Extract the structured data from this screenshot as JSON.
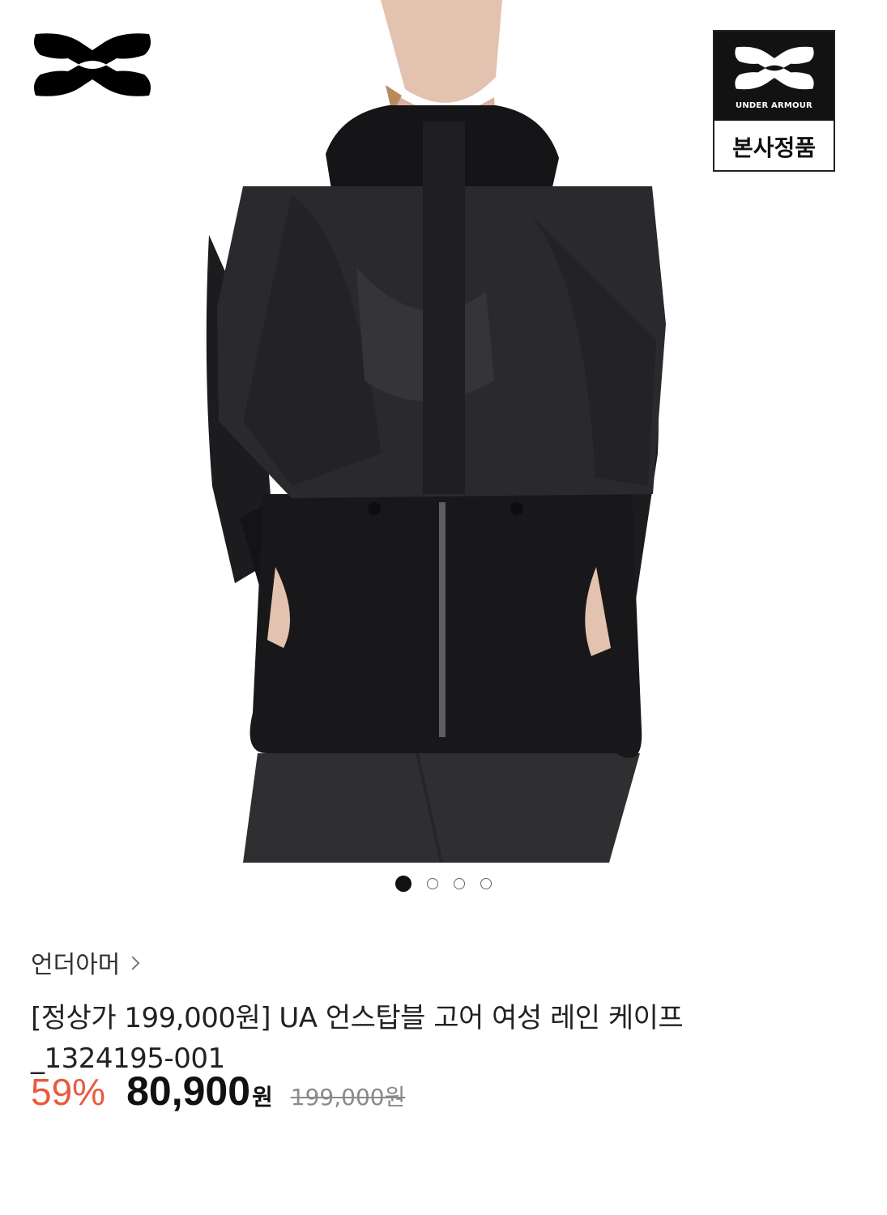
{
  "image": {
    "alt": "UA 언스탑블 고어 여성 레인 케이프 black hooded jacket",
    "brand_logo_icon": "under-armour-logo",
    "badge": {
      "brand_text": "UNDER ARMOUR",
      "label": "본사정품"
    }
  },
  "carousel": {
    "total": 4,
    "active_index": 0
  },
  "product": {
    "brand": "언더아머",
    "title": "[정상가 199,000원] UA 언스탑블 고어 여성 레인 케이프_1324195-001",
    "discount": "59%",
    "sale_price": "80,900",
    "sale_unit": "원",
    "original_price": "199,000원"
  },
  "colors": {
    "discount": "#ea5a3f",
    "text": "#222222"
  }
}
